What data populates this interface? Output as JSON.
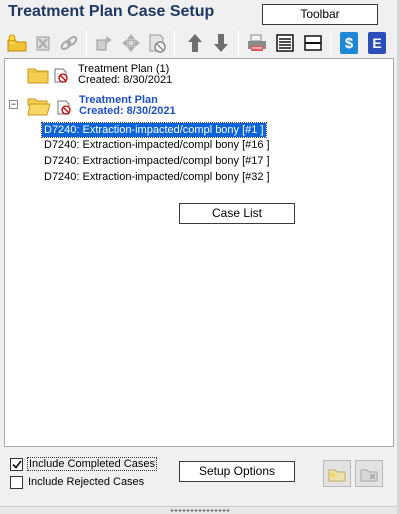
{
  "header": {
    "title": "Treatment Plan Case Setup",
    "toolbar_button": "Toolbar"
  },
  "toolbar": {
    "icons": [
      "new-case-icon",
      "delete-case-icon",
      "link-icon",
      "move-icon",
      "arrange-icon",
      "reject-icon",
      "move-up-icon",
      "move-down-icon",
      "print-icon",
      "list-view-icon",
      "collapse-icon",
      "dollar-icon",
      "e-icon"
    ]
  },
  "tree": {
    "nodes": [
      {
        "title": "Treatment Plan (1)",
        "subtitle": "Created: 8/30/2021"
      },
      {
        "title": "Treatment Plan",
        "subtitle": "Created: 8/30/2021"
      }
    ],
    "procedures": [
      "D7240: Extraction-impacted/compl bony [#1 ]",
      "D7240: Extraction-impacted/compl bony [#16 ]",
      "D7240: Extraction-impacted/compl bony [#17 ]",
      "D7240: Extraction-impacted/compl bony [#32 ]"
    ],
    "case_list_button": "Case List"
  },
  "options": {
    "include_completed": {
      "label": "Include Completed Cases",
      "checked": true
    },
    "include_rejected": {
      "label": "Include Rejected Cases",
      "checked": false
    },
    "setup_button": "Setup Options"
  },
  "colors": {
    "title": "#1f3864",
    "selected_node": "#1f4fc4",
    "selection_bg": "#0a64d8"
  }
}
